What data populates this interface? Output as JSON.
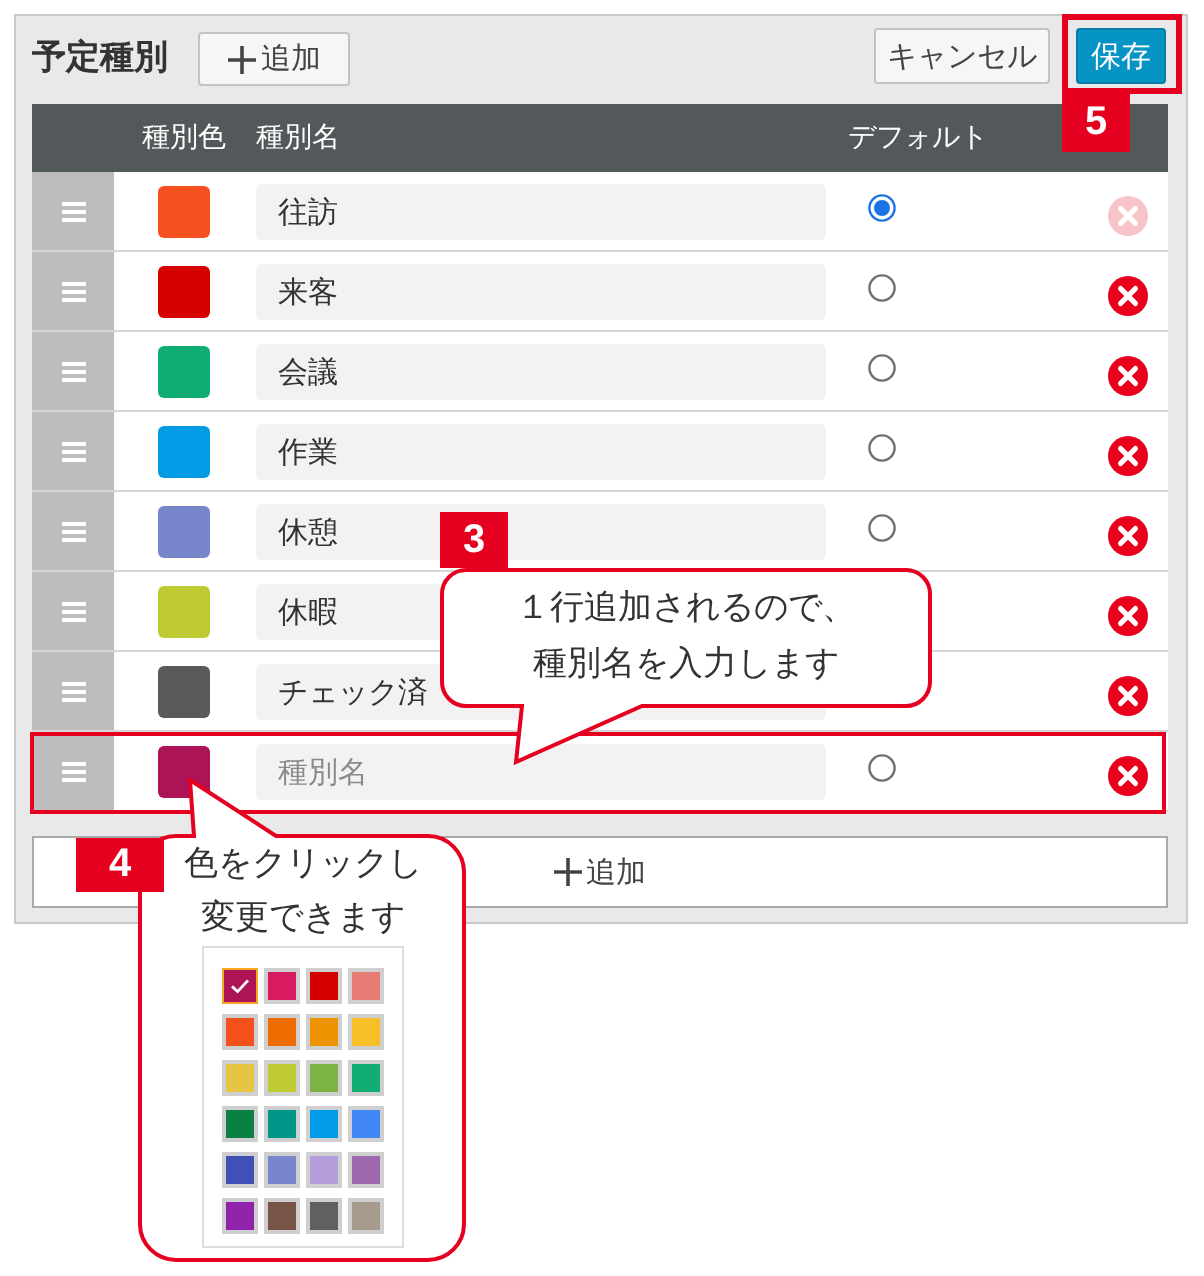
{
  "header": {
    "title": "予定種別",
    "add_button": "追加",
    "cancel_button": "キャンセル",
    "save_button": {
      "label": "保存",
      "highlighted": true,
      "badge": "5"
    }
  },
  "table": {
    "columns": [
      "種別色",
      "種別名",
      "デフォルト"
    ],
    "rows": [
      {
        "color": "#f4511e",
        "name": "往訪",
        "selected": true,
        "delete_disabled": true,
        "highlighted": false
      },
      {
        "color": "#d50000",
        "name": "来客",
        "selected": false,
        "delete_disabled": false,
        "highlighted": false
      },
      {
        "color": "#12ad73",
        "name": "会議",
        "selected": false,
        "delete_disabled": false,
        "highlighted": false
      },
      {
        "color": "#039be5",
        "name": "作業",
        "selected": false,
        "delete_disabled": false,
        "highlighted": false
      },
      {
        "color": "#7986cb",
        "name": "休憩",
        "selected": false,
        "delete_disabled": false,
        "highlighted": false
      },
      {
        "color": "#c0ca33",
        "name": "休暇",
        "delete_disabled": false,
        "highlighted": false
      },
      {
        "color": "#5a5a5a",
        "name": "チェック済",
        "delete_disabled": false,
        "highlighted": false
      },
      {
        "color": "#ad1457",
        "placeholder": "種別名",
        "selected": false,
        "delete_disabled": false,
        "highlighted": true
      }
    ]
  },
  "add_row_button": "追加",
  "callouts": [
    {
      "badge": "3",
      "kind": "tail-bottom",
      "text": "１行追加されるので、種別名を入力します"
    },
    {
      "badge": "4",
      "kind": "tail-top",
      "text": "色をクリックし変更できます",
      "palette": [
        {
          "color": "#ad1457",
          "selected": true
        },
        {
          "color": "#d81b60",
          "selected": false
        },
        {
          "color": "#d50000",
          "selected": false
        },
        {
          "color": "#e67c73",
          "selected": false
        },
        {
          "color": "#f4511e",
          "selected": false
        },
        {
          "color": "#ef6c00",
          "selected": false
        },
        {
          "color": "#f09300",
          "selected": false
        },
        {
          "color": "#f6bf26",
          "selected": false
        },
        {
          "color": "#e4c441",
          "selected": false
        },
        {
          "color": "#c0ca33",
          "selected": false
        },
        {
          "color": "#7cb342",
          "selected": false
        },
        {
          "color": "#12ad73",
          "selected": false
        },
        {
          "color": "#0b8043",
          "selected": false
        },
        {
          "color": "#009688",
          "selected": false
        },
        {
          "color": "#039be5",
          "selected": false
        },
        {
          "color": "#4285f4",
          "selected": false
        },
        {
          "color": "#3f51b5",
          "selected": false
        },
        {
          "color": "#7986cb",
          "selected": false
        },
        {
          "color": "#b39ddb",
          "selected": false
        },
        {
          "color": "#9e69af",
          "selected": false
        },
        {
          "color": "#8e24aa",
          "selected": false
        },
        {
          "color": "#795548",
          "selected": false
        },
        {
          "color": "#616161",
          "selected": false
        },
        {
          "color": "#a79b8e",
          "selected": false
        }
      ]
    }
  ]
}
